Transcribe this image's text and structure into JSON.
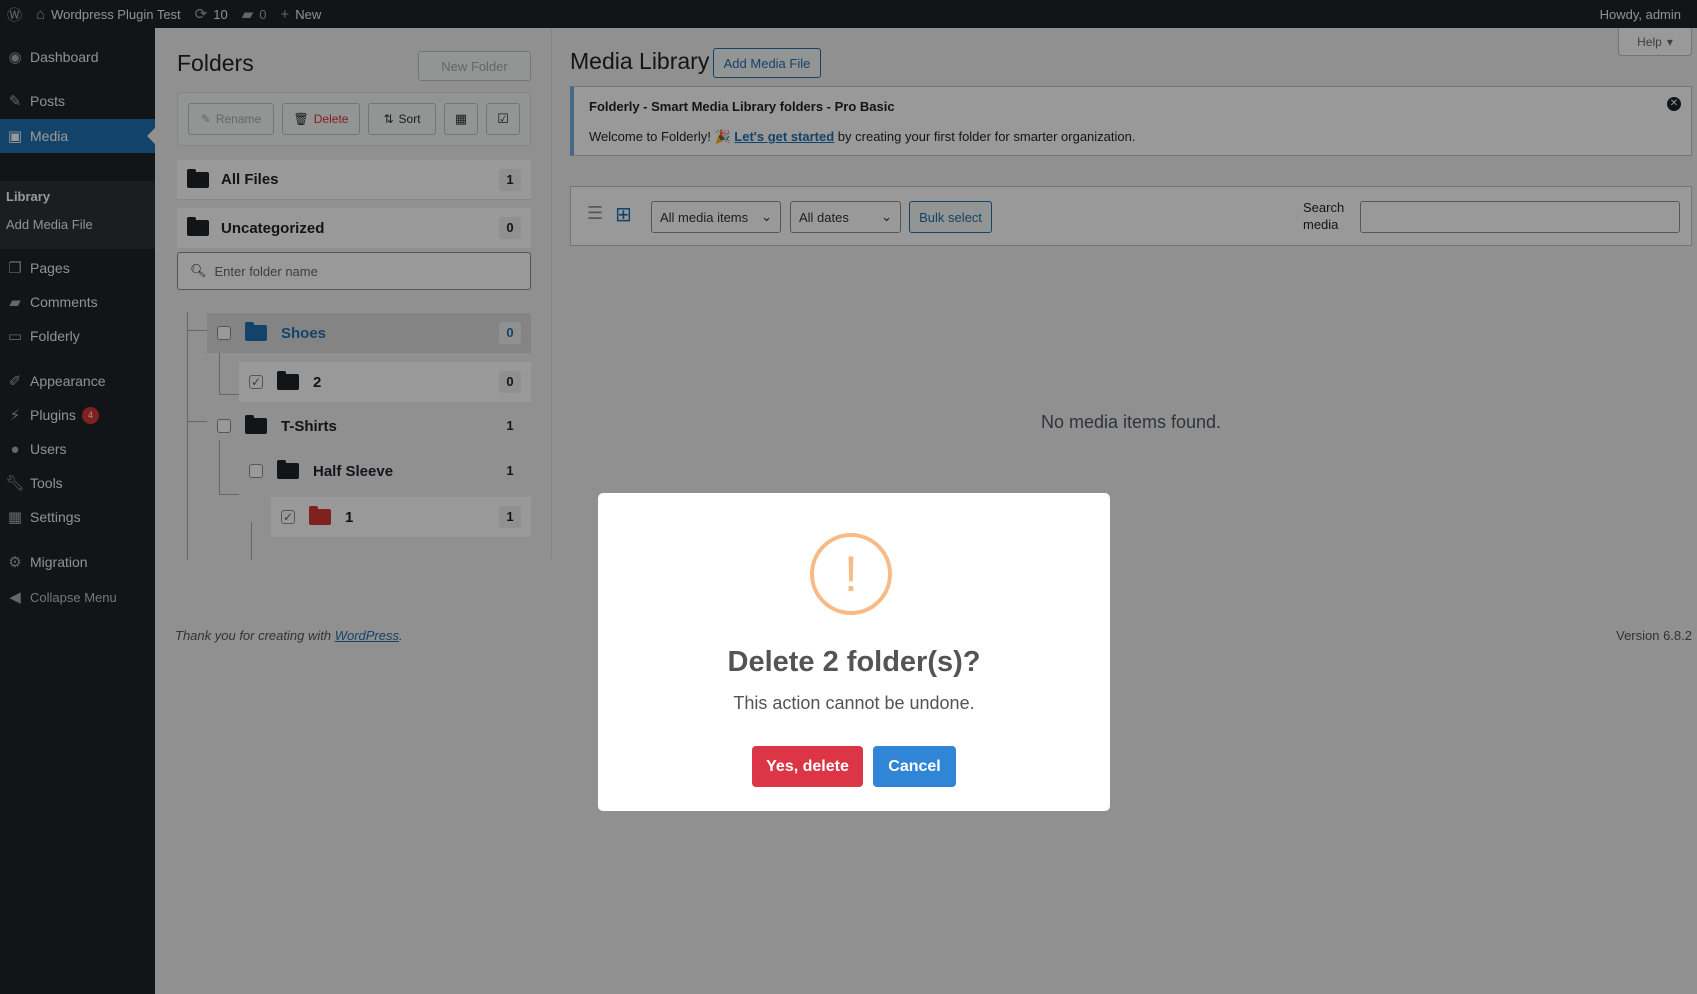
{
  "adminbar": {
    "site_name": "Wordpress Plugin Test",
    "updates": "10",
    "comments": "0",
    "new_label": "New",
    "howdy": "Howdy, admin"
  },
  "sidebar": {
    "dashboard": "Dashboard",
    "posts": "Posts",
    "media": "Media",
    "library": "Library",
    "add_media_file": "Add Media File",
    "pages": "Pages",
    "comments": "Comments",
    "folderly": "Folderly",
    "appearance": "Appearance",
    "plugins": "Plugins",
    "plugins_badge": "4",
    "users": "Users",
    "tools": "Tools",
    "settings": "Settings",
    "migration": "Migration",
    "collapse": "Collapse Menu"
  },
  "folders": {
    "title": "Folders",
    "new_folder": "New Folder",
    "rename": "Rename",
    "delete": "Delete",
    "sort": "Sort",
    "all_files": "All Files",
    "all_files_count": "1",
    "uncategorized": "Uncategorized",
    "uncategorized_count": "0",
    "search_placeholder": "Enter folder name",
    "tree": [
      {
        "name": "Shoes",
        "count": "0"
      },
      {
        "name": "2",
        "count": "0"
      },
      {
        "name": "T-Shirts",
        "count": "1"
      },
      {
        "name": "Half Sleeve",
        "count": "1"
      },
      {
        "name": "1",
        "count": "1"
      }
    ]
  },
  "media": {
    "title": "Media Library",
    "add_button": "Add Media File",
    "notice_title": "Folderly - Smart Media Library folders - Pro Basic",
    "notice_pre": "Welcome to Folderly! 🎉 ",
    "notice_link": "Let's get started",
    "notice_post": " by creating your first folder for smarter organization.",
    "filter_type": "All media items",
    "filter_date": "All dates",
    "bulk_select": "Bulk select",
    "search_label": "Search media",
    "empty": "No media items found.",
    "help": "Help"
  },
  "footer": {
    "thanks": "Thank you for creating with ",
    "wp_link": "WordPress",
    "period": ".",
    "version": "Version 6.8.2"
  },
  "modal": {
    "title": "Delete 2 folder(s)?",
    "text": "This action cannot be undone.",
    "confirm": "Yes, delete",
    "cancel": "Cancel",
    "confirm_color": "#dc3545",
    "cancel_color": "#3085d6"
  }
}
